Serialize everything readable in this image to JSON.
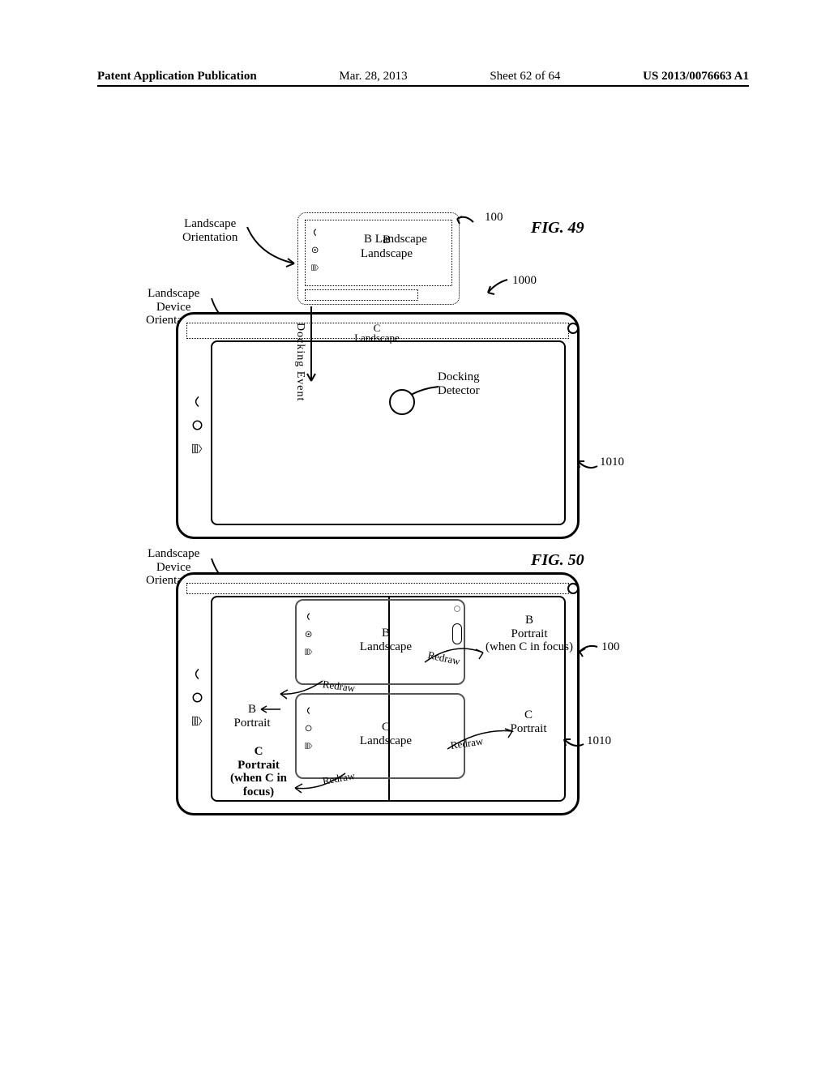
{
  "header": {
    "publication": "Patent Application Publication",
    "date": "Mar. 28, 2013",
    "sheet": "Sheet 62 of 64",
    "docnum": "US 2013/0076663 A1"
  },
  "figures": {
    "fig49": "FIG. 49",
    "fig50": "FIG. 50"
  },
  "labels": {
    "landscape_orient": "Landscape\nOrientation",
    "landscape_dev_orient": "Landscape\nDevice\nOrientation",
    "docking_event_v": "Docking\nEvent",
    "docking_detector": "Docking\nDetector",
    "b_landscape": "B\nLandscape",
    "c_landscape_top": "C\nLandscape",
    "b_landscape2": "B\nLandscape",
    "c_landscape2": "C\nLandscape",
    "b_portrait": "B\nPortrait",
    "c_portrait": "C\nPortrait",
    "b_portrait_focus": "B\nPortrait\n(when C in focus)",
    "c_portrait_focus_bold": "C\nPortrait\n(when C in focus)",
    "redraw": "Redraw"
  },
  "refs": {
    "r100": "100",
    "r1000": "1000",
    "r1010": "1010",
    "r100b": "100",
    "r1010b": "1010"
  }
}
